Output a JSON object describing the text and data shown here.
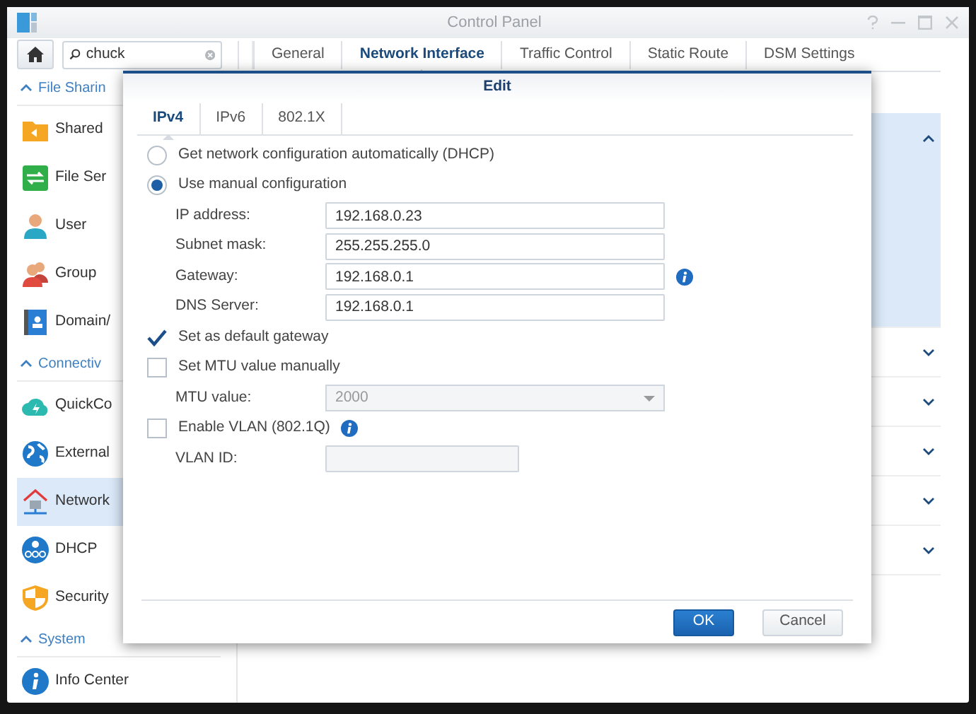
{
  "window": {
    "title": "Control Panel"
  },
  "search": {
    "value": "chuck"
  },
  "tabs": [
    {
      "label": "General",
      "selected": false
    },
    {
      "label": "Network Interface",
      "selected": true
    },
    {
      "label": "Traffic Control",
      "selected": false
    },
    {
      "label": "Static Route",
      "selected": false
    },
    {
      "label": "DSM Settings",
      "selected": false
    }
  ],
  "sidebar": {
    "sections": [
      {
        "title": "File Sharin",
        "expanded": true,
        "items": [
          {
            "label": "Shared",
            "kind": "folder",
            "selected": false
          },
          {
            "label": "File Ser",
            "kind": "transfer",
            "selected": false
          },
          {
            "label": "User",
            "kind": "user",
            "selected": false
          },
          {
            "label": "Group",
            "kind": "group",
            "selected": false
          },
          {
            "label": "Domain/",
            "kind": "directory",
            "selected": false
          }
        ]
      },
      {
        "title": "Connectiv",
        "expanded": true,
        "items": [
          {
            "label": "QuickCo",
            "kind": "cloud",
            "selected": false
          },
          {
            "label": "External",
            "kind": "globe",
            "selected": false
          },
          {
            "label": "Network",
            "kind": "house",
            "selected": true
          },
          {
            "label": "DHCP",
            "kind": "hub",
            "selected": false
          },
          {
            "label": "Security",
            "kind": "shield",
            "selected": false
          }
        ]
      },
      {
        "title": "System",
        "expanded": true,
        "items": [
          {
            "label": "Info Center",
            "kind": "info",
            "selected": false
          }
        ]
      }
    ]
  },
  "content_rows": [
    {
      "expanded": true
    },
    {
      "expanded": false
    },
    {
      "expanded": false
    },
    {
      "expanded": false
    },
    {
      "expanded": false
    },
    {
      "expanded": false
    }
  ],
  "dialog": {
    "title": "Edit",
    "tabs": [
      {
        "label": "IPv4",
        "selected": true
      },
      {
        "label": "IPv6",
        "selected": false
      },
      {
        "label": "802.1X",
        "selected": false
      }
    ],
    "rows": [
      {
        "kind": "radio",
        "label": "Get network configuration automatically (DHCP)",
        "selected": false
      },
      {
        "kind": "radio",
        "label": "Use manual configuration",
        "selected": true
      },
      {
        "kind": "field",
        "label": "IP address:",
        "value": "192.168.0.23",
        "disabled": false
      },
      {
        "kind": "field",
        "label": "Subnet mask:",
        "value": "255.255.255.0",
        "disabled": false
      },
      {
        "kind": "field",
        "label": "Gateway:",
        "value": "192.168.0.1",
        "disabled": false,
        "info": true
      },
      {
        "kind": "field",
        "label": "DNS Server:",
        "value": "192.168.0.1",
        "disabled": false
      },
      {
        "kind": "checkbox",
        "label": "Set as default gateway",
        "checked": true
      },
      {
        "kind": "checkbox",
        "label": "Set MTU value manually",
        "checked": false
      },
      {
        "kind": "select",
        "label": "MTU value:",
        "value": "2000",
        "disabled": true
      },
      {
        "kind": "checkbox",
        "label": "Enable VLAN (802.1Q)",
        "checked": false,
        "info": true
      },
      {
        "kind": "field",
        "label": "VLAN ID:",
        "disabled": true
      }
    ],
    "buttons": [
      {
        "label": "OK",
        "kind": "primary"
      },
      {
        "label": "Cancel",
        "kind": "secondary"
      }
    ]
  }
}
